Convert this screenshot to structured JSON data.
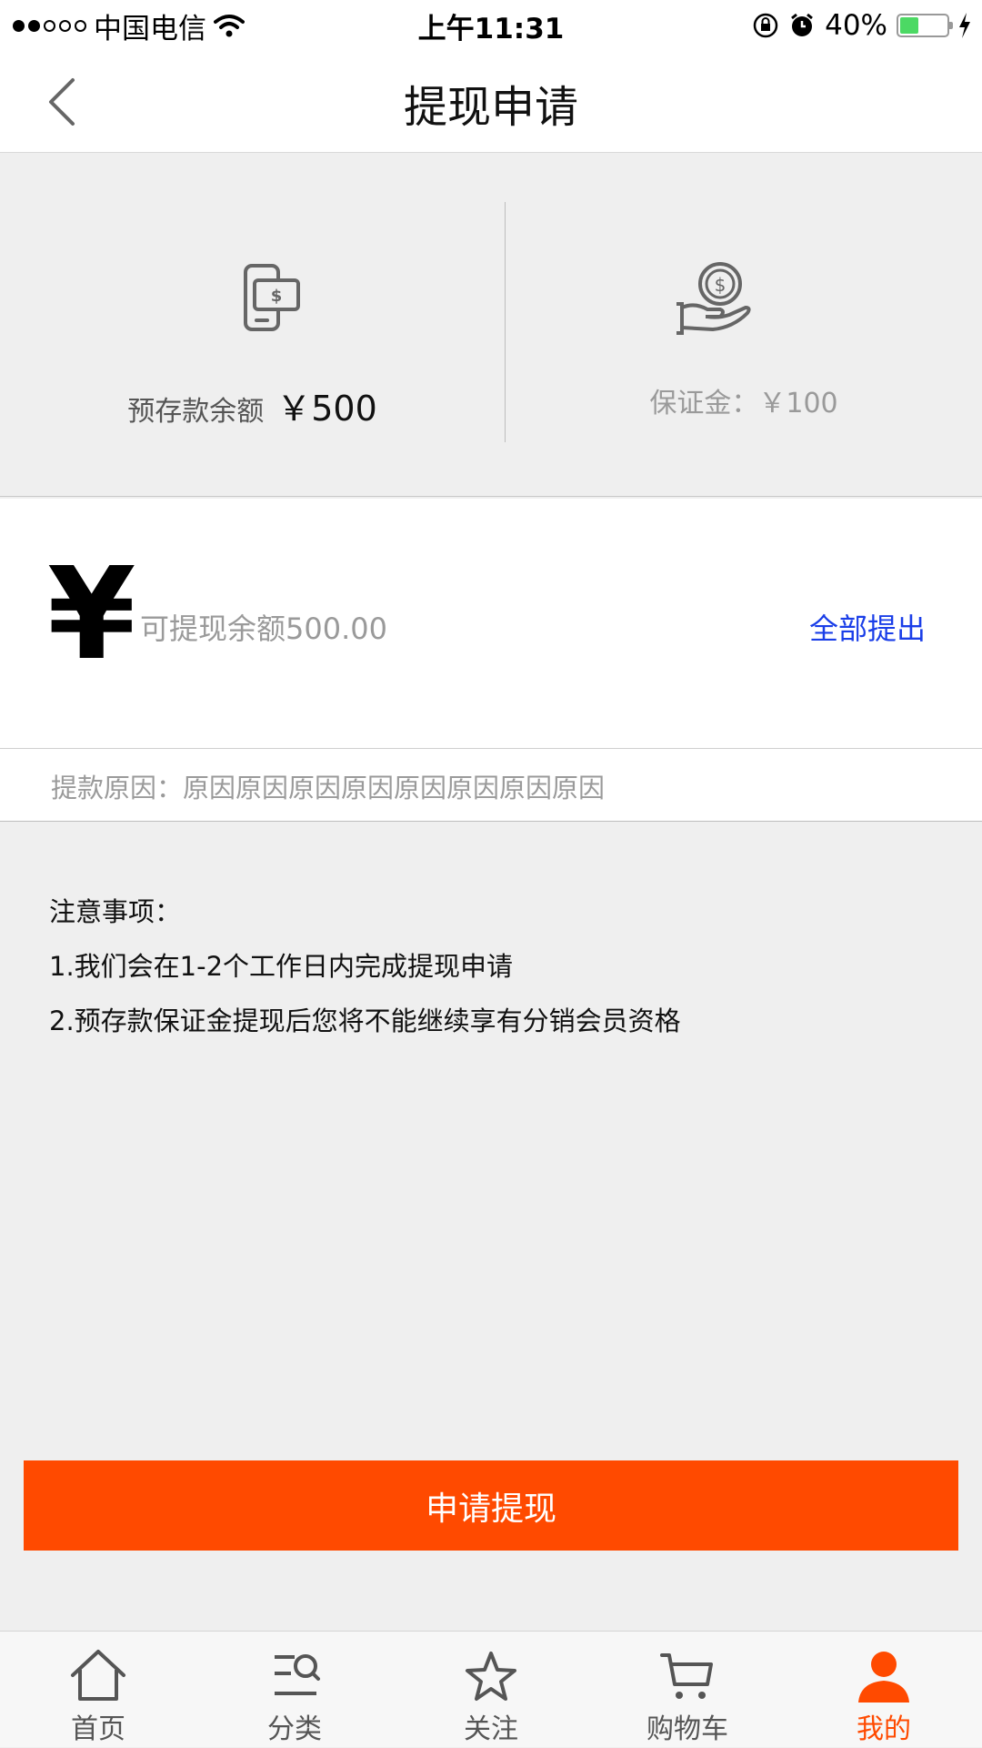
{
  "status_bar": {
    "carrier": "中国电信",
    "time": "上午11:31",
    "battery": "40%",
    "battery_level": 0.4
  },
  "nav": {
    "title": "提现申请"
  },
  "balances": {
    "deposit_label": "预存款余额",
    "deposit_amount": "￥500",
    "security_label": "保证金：￥100"
  },
  "withdraw": {
    "currency_symbol": "¥",
    "available_text": "可提现余额500.00",
    "withdraw_all_label": "全部提出"
  },
  "reason": {
    "text": "提款原因：原因原因原因原因原因原因原因原因"
  },
  "notes": {
    "title": "注意事项：",
    "items": [
      "1.我们会在1-2个工作日内完成提现申请",
      "2.预存款保证金提现后您将不能继续享有分销会员资格"
    ]
  },
  "submit_label": "申请提现",
  "tabs": [
    {
      "label": "首页",
      "icon": "home-icon"
    },
    {
      "label": "分类",
      "icon": "category-search-icon"
    },
    {
      "label": "关注",
      "icon": "star-icon"
    },
    {
      "label": "购物车",
      "icon": "cart-icon"
    },
    {
      "label": "我的",
      "icon": "user-icon",
      "active": true
    }
  ],
  "colors": {
    "accent": "#ff4a00",
    "link": "#1a3ee8",
    "battery": "#4cd964"
  }
}
